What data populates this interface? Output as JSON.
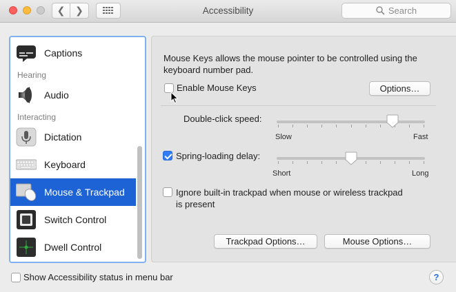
{
  "window": {
    "title": "Accessibility",
    "search_placeholder": "Search"
  },
  "sidebar": {
    "items": [
      {
        "label": "Captions",
        "icon": "captions-icon"
      },
      {
        "header": "Hearing"
      },
      {
        "label": "Audio",
        "icon": "speaker-icon"
      },
      {
        "header": "Interacting"
      },
      {
        "label": "Dictation",
        "icon": "microphone-icon"
      },
      {
        "label": "Keyboard",
        "icon": "keyboard-icon"
      },
      {
        "label": "Mouse & Trackpad",
        "icon": "mouse-trackpad-icon",
        "selected": true
      },
      {
        "label": "Switch Control",
        "icon": "switch-control-icon"
      },
      {
        "label": "Dwell Control",
        "icon": "dwell-control-icon"
      }
    ]
  },
  "main": {
    "description": "Mouse Keys allows the mouse pointer to be controlled using the keyboard number pad.",
    "enable_mouse_keys": {
      "label": "Enable Mouse Keys",
      "checked": false
    },
    "options_button": "Options…",
    "double_click": {
      "label": "Double-click speed:",
      "min_label": "Slow",
      "max_label": "Fast",
      "value": 0.78
    },
    "spring_loading": {
      "label": "Spring-loading delay:",
      "checked": true,
      "min_label": "Short",
      "max_label": "Long",
      "value": 0.5
    },
    "ignore_trackpad": {
      "label_line1": "Ignore built-in trackpad when mouse or wireless trackpad",
      "label_line2": "is present",
      "checked": false
    },
    "trackpad_options_button": "Trackpad Options…",
    "mouse_options_button": "Mouse Options…"
  },
  "footer": {
    "status_checkbox_label": "Show Accessibility status in menu bar",
    "status_checked": false,
    "help_label": "?"
  },
  "colors": {
    "selection": "#1e63d6",
    "focus_ring": "#7fb0f2",
    "checkbox_checked": "#2f7cf6"
  }
}
